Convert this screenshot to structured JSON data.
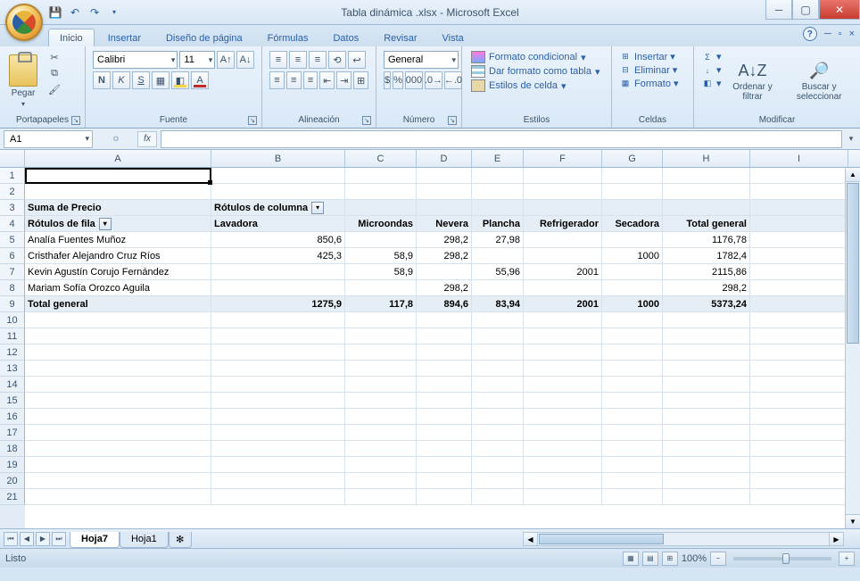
{
  "title": "Tabla dinámica .xlsx - Microsoft Excel",
  "tabs": {
    "active": "Inicio",
    "items": [
      "Inicio",
      "Insertar",
      "Diseño de página",
      "Fórmulas",
      "Datos",
      "Revisar",
      "Vista"
    ]
  },
  "ribbon": {
    "clipboard": {
      "label": "Portapapeles",
      "paste": "Pegar"
    },
    "font": {
      "label": "Fuente",
      "name": "Calibri",
      "size": "11"
    },
    "align": {
      "label": "Alineación"
    },
    "number": {
      "label": "Número",
      "format": "General"
    },
    "styles": {
      "label": "Estilos",
      "cond": "Formato condicional",
      "table": "Dar formato como tabla",
      "cell": "Estilos de celda"
    },
    "cells": {
      "label": "Celdas",
      "insert": "Insertar",
      "delete": "Eliminar",
      "format": "Formato"
    },
    "modify": {
      "label": "Modificar",
      "sort": "Ordenar y filtrar",
      "find": "Buscar y seleccionar"
    }
  },
  "name_box": "A1",
  "columns": [
    "A",
    "B",
    "C",
    "D",
    "E",
    "F",
    "G",
    "H",
    "I"
  ],
  "pivot": {
    "measure": "Suma de Precio",
    "col_label": "Rótulos de columna",
    "row_label": "Rótulos de fila",
    "col_headers": [
      "Lavadora",
      "Microondas",
      "Nevera",
      "Plancha",
      "Refrigerador",
      "Secadora",
      "Total general"
    ],
    "rows": [
      {
        "name": "Analía Fuentes Muñoz",
        "vals": [
          "850,6",
          "",
          "298,2",
          "27,98",
          "",
          "",
          "1176,78"
        ]
      },
      {
        "name": "Cristhafer Alejandro Cruz Ríos",
        "vals": [
          "425,3",
          "58,9",
          "298,2",
          "",
          "",
          "1000",
          "1782,4"
        ]
      },
      {
        "name": "Kevin Agustín Corujo Fernández",
        "vals": [
          "",
          "58,9",
          "",
          "55,96",
          "2001",
          "",
          "2115,86"
        ]
      },
      {
        "name": "Mariam Sofía Orozco Aguila",
        "vals": [
          "",
          "",
          "298,2",
          "",
          "",
          "",
          "298,2"
        ]
      }
    ],
    "total_label": "Total general",
    "totals": [
      "1275,9",
      "117,8",
      "894,6",
      "83,94",
      "2001",
      "1000",
      "5373,24"
    ]
  },
  "sheets": {
    "active": "Hoja7",
    "items": [
      "Hoja7",
      "Hoja1"
    ]
  },
  "status": {
    "ready": "Listo",
    "zoom": "100%"
  },
  "chart_data": {
    "type": "table",
    "title": "Suma de Precio",
    "columns": [
      "Lavadora",
      "Microondas",
      "Nevera",
      "Plancha",
      "Refrigerador",
      "Secadora",
      "Total general"
    ],
    "rows": [
      "Analía Fuentes Muñoz",
      "Cristhafer Alejandro Cruz Ríos",
      "Kevin Agustín Corujo Fernández",
      "Mariam Sofía Orozco Aguila",
      "Total general"
    ],
    "values": [
      [
        850.6,
        null,
        298.2,
        27.98,
        null,
        null,
        1176.78
      ],
      [
        425.3,
        58.9,
        298.2,
        null,
        null,
        1000,
        1782.4
      ],
      [
        null,
        58.9,
        null,
        55.96,
        2001,
        null,
        2115.86
      ],
      [
        null,
        null,
        298.2,
        null,
        null,
        null,
        298.2
      ],
      [
        1275.9,
        117.8,
        894.6,
        83.94,
        2001,
        1000,
        5373.24
      ]
    ]
  }
}
